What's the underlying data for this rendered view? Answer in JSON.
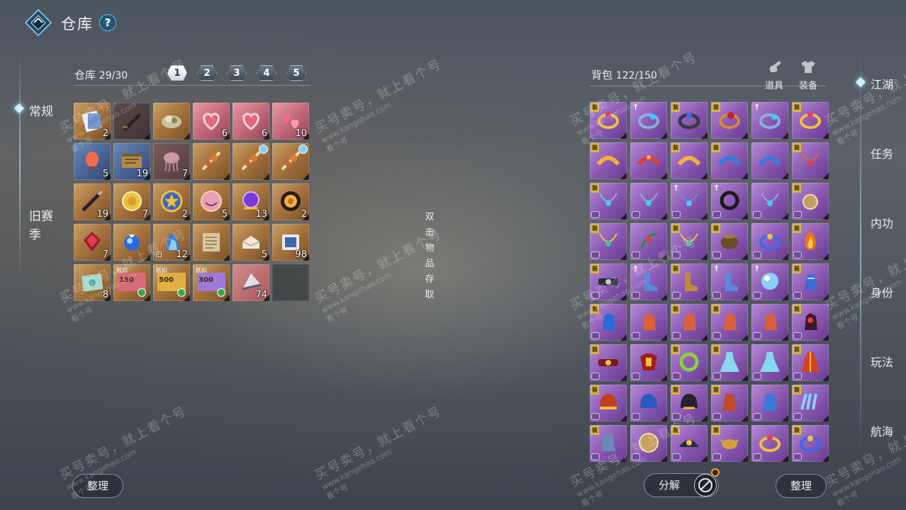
{
  "header": {
    "title": "仓库",
    "help": "?"
  },
  "left_nav": [
    {
      "label": "常规",
      "active": true
    },
    {
      "label": "旧赛季",
      "active": false
    }
  ],
  "warehouse": {
    "label": "仓库",
    "count": "29/30",
    "pages": [
      "1",
      "2",
      "3",
      "4",
      "5"
    ],
    "active_page": "1",
    "items": [
      {
        "art": "card",
        "q": "gold",
        "count": "2"
      },
      {
        "art": "dagger",
        "q": "dark",
        "count": ""
      },
      {
        "art": "food",
        "q": "gold",
        "count": ""
      },
      {
        "art": "heart",
        "q": "pink",
        "count": "6"
      },
      {
        "art": "heart",
        "q": "pink",
        "count": "6"
      },
      {
        "art": "hearts",
        "q": "pink",
        "count": "10"
      },
      {
        "art": "lantern",
        "q": "blue",
        "count": "5"
      },
      {
        "art": "scroll",
        "q": "blue",
        "count": "19"
      },
      {
        "art": "jelly",
        "q": "jelly",
        "count": "7"
      },
      {
        "art": "stick",
        "q": "gold",
        "count": ""
      },
      {
        "art": "stick",
        "q": "gold",
        "count": "",
        "frost": true
      },
      {
        "art": "stick",
        "q": "gold",
        "count": "",
        "frost": true
      },
      {
        "art": "brush",
        "q": "gold",
        "count": "19"
      },
      {
        "art": "coin",
        "q": "gold",
        "count": "7"
      },
      {
        "art": "star",
        "q": "gold",
        "count": "2"
      },
      {
        "art": "face",
        "q": "gold",
        "count": "5"
      },
      {
        "art": "orb",
        "q": "gold",
        "count": "13"
      },
      {
        "art": "rose",
        "q": "gold",
        "count": "2"
      },
      {
        "art": "redgem",
        "q": "gold",
        "count": "7"
      },
      {
        "art": "bluebag",
        "q": "gold",
        "count": ""
      },
      {
        "art": "crystal",
        "q": "gold",
        "count": "12",
        "tag": "旧"
      },
      {
        "art": "paper",
        "q": "gold",
        "count": ""
      },
      {
        "art": "envelope",
        "q": "gold",
        "count": "5"
      },
      {
        "art": "book",
        "q": "gold",
        "count": "98"
      },
      {
        "art": "map",
        "q": "gold",
        "count": "8"
      },
      {
        "art": "ticket",
        "q": "gold",
        "count": "",
        "ticket_label": "抵扣",
        "ticket_num": "150",
        "ticket_color": "#d86a7a"
      },
      {
        "art": "ticket",
        "q": "gold",
        "count": "",
        "ticket_label": "抵扣",
        "ticket_num": "500",
        "ticket_color": "#e0b045"
      },
      {
        "art": "ticket",
        "q": "gold",
        "count": "",
        "ticket_label": "抵扣",
        "ticket_num": "300",
        "ticket_color": "#9f7ad8"
      },
      {
        "art": "fan",
        "q": "red",
        "count": "74"
      },
      {
        "art": "empty",
        "q": "empty",
        "count": ""
      }
    ]
  },
  "hint_vertical": [
    "双",
    "击",
    "物",
    "品",
    "存",
    "取"
  ],
  "backpack": {
    "label": "背包",
    "count": "122/150",
    "tools": [
      {
        "name": "props",
        "label": "道具"
      },
      {
        "name": "equipment",
        "label": "装备"
      }
    ],
    "rows": [
      [
        "ring-gold",
        "ring-blue-up",
        "ring-gem",
        "ring-red",
        "ring-blue-up",
        "ring-gold"
      ],
      [
        "brace-gold",
        "brace-red",
        "brace-gold",
        "brace-blue",
        "brace-blue",
        "neck-red"
      ],
      [
        "neck-blue",
        "neck-blue",
        "neck-blue-up",
        "ring-black-up",
        "neck-blue",
        "pendant"
      ],
      [
        "neck-gold",
        "neck-green",
        "neck-gold",
        "pot",
        "ring-blue",
        "fire"
      ],
      [
        "belt",
        "boot-up",
        "boot",
        "boot-up",
        "orb-up",
        "gauntlet"
      ],
      [
        "glove-blue",
        "glove-red",
        "glove-red",
        "glove-red",
        "glove-red",
        "glove-dark"
      ],
      [
        "belt-red",
        "armor",
        "jade",
        "dress",
        "dress",
        "robe"
      ],
      [
        "helm",
        "helm-blue",
        "helm-dark",
        "arm",
        "arm-blue",
        "claw"
      ],
      [
        "bracer",
        "disc",
        "shoulder",
        "crab",
        "ring-gold",
        "ring-blue"
      ]
    ]
  },
  "right_nav": [
    "江湖",
    "任务",
    "内功",
    "身份",
    "玩法",
    "航海"
  ],
  "buttons": {
    "sort_left": "整理",
    "decompose": "分解",
    "sort_right": "整理"
  },
  "watermark": {
    "line1": "买号卖号，就上看个号",
    "line2": "www.kangehao.com",
    "line3": "看个号"
  },
  "colors": {
    "gold_quality": "#b07c45",
    "purple_quality": "#8c5bb4",
    "pink_quality": "#c46a7b",
    "blue_quality": "#4b6596"
  }
}
